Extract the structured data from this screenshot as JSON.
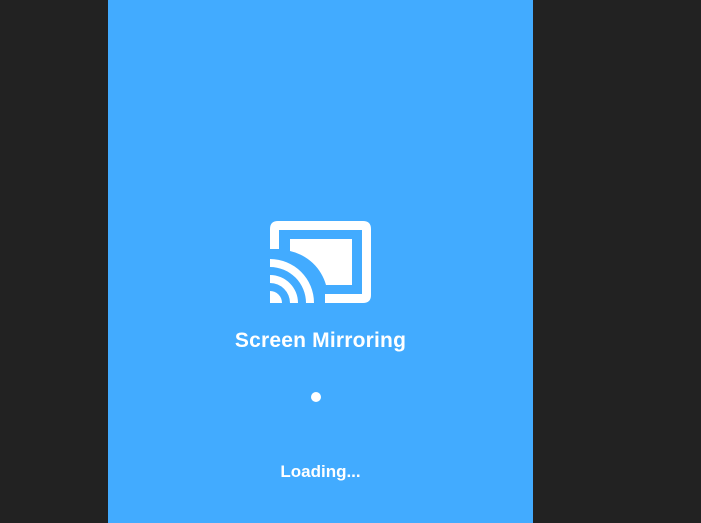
{
  "splash": {
    "icon": "screen-cast-icon",
    "title": "Screen Mirroring",
    "loading_text": "Loading..."
  },
  "colors": {
    "background_outer": "#222222",
    "screen_background": "#42abff",
    "foreground": "#ffffff"
  }
}
